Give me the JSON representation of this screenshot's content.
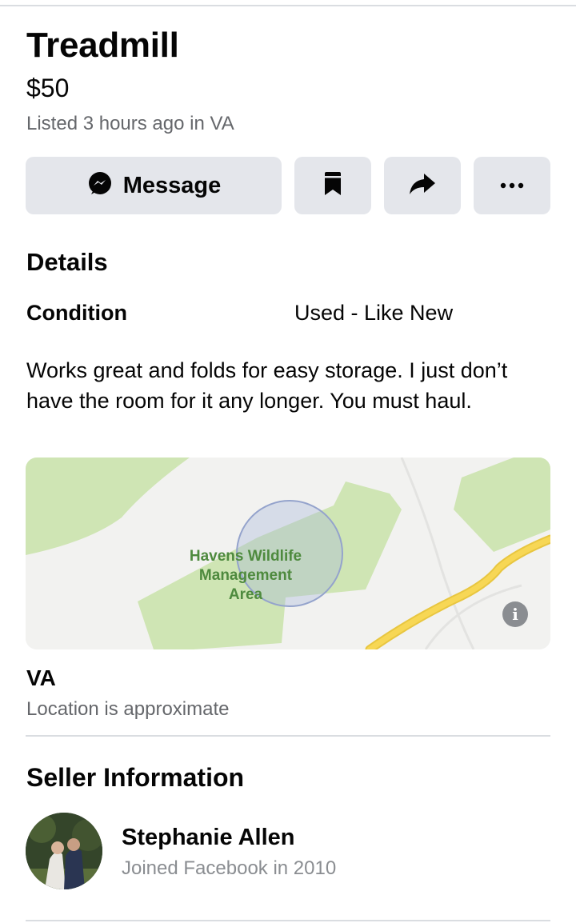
{
  "listing": {
    "title": "Treadmill",
    "price": "$50",
    "listed": "Listed 3 hours ago in VA"
  },
  "actions": {
    "message_label": "Message",
    "icons": [
      "messenger-icon",
      "bookmark-icon",
      "share-icon",
      "more-icon"
    ],
    "more_glyph": "•••"
  },
  "details": {
    "heading": "Details",
    "condition_label": "Condition",
    "condition_value": "Used - Like New",
    "description": "Works great and folds for easy storage. I just don’t have the room for it any longer. You must haul."
  },
  "map": {
    "label_line1": "Havens Wildlife",
    "label_line2": "Management",
    "label_line3": "Area",
    "info_glyph": "i",
    "colors": {
      "park": "#cfe5b4",
      "road": "#f7d755",
      "radius": "#a9b7d9"
    }
  },
  "location": {
    "name": "VA",
    "note": "Location is approximate"
  },
  "seller": {
    "heading": "Seller Information",
    "name": "Stephanie Allen",
    "joined": "Joined Facebook in 2010"
  }
}
